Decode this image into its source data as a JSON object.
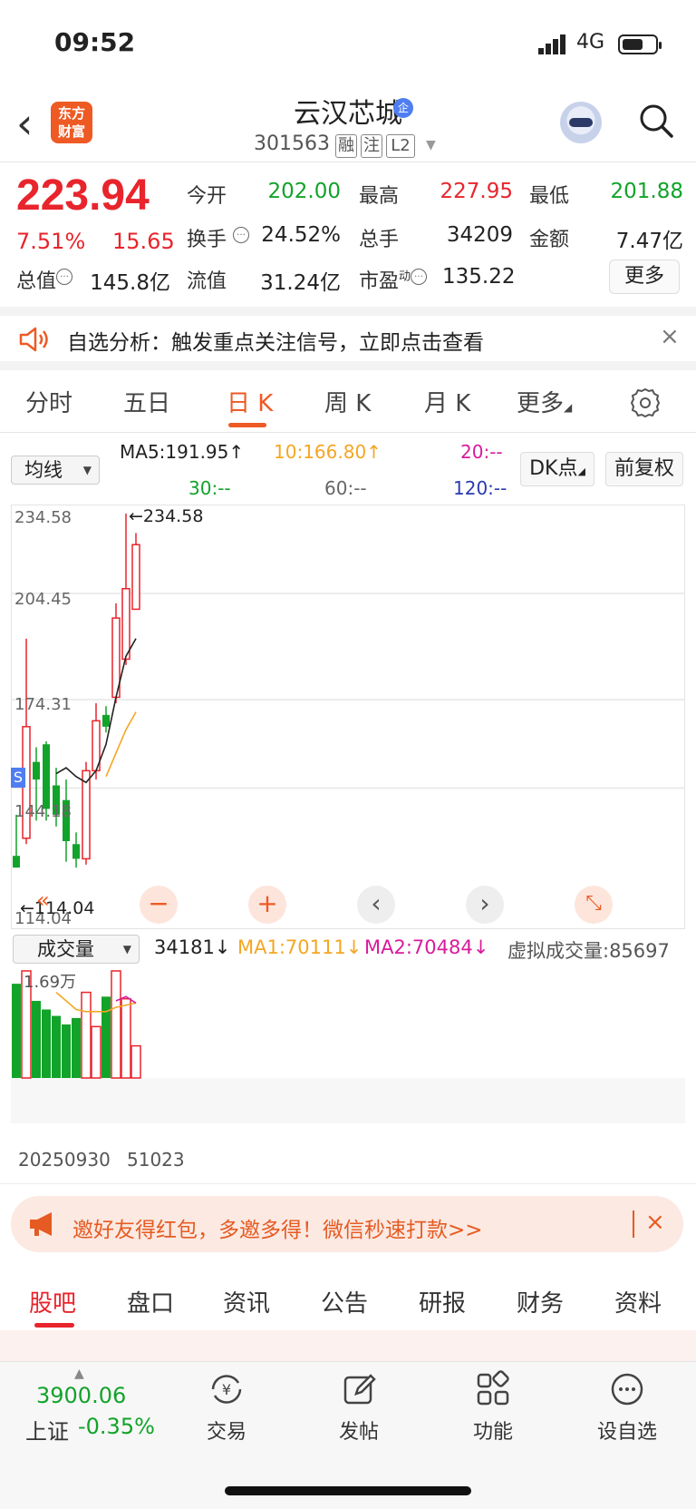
{
  "status": {
    "time": "09:52",
    "network": "4G"
  },
  "header": {
    "logo_line1": "东方",
    "logo_line2": "财富",
    "name": "云汉芯城",
    "badge": "企",
    "code": "301563",
    "tags": [
      "融",
      "注",
      "L2"
    ]
  },
  "quote": {
    "price": "223.94",
    "change_pct": "7.51%",
    "change": "15.65",
    "cells": [
      {
        "label": "今开",
        "value": "202.00",
        "color": "green"
      },
      {
        "label": "最高",
        "value": "227.95",
        "color": "red"
      },
      {
        "label": "最低",
        "value": "201.88",
        "color": "green"
      },
      {
        "label": "换手",
        "value": "24.52%",
        "color": "dark"
      },
      {
        "label": "总手",
        "value": "34209",
        "color": "dark"
      },
      {
        "label": "金额",
        "value": "7.47亿",
        "color": "dark"
      },
      {
        "label": "总值",
        "value": "145.8亿",
        "color": "dark"
      },
      {
        "label": "流值",
        "value": "31.24亿",
        "color": "dark"
      },
      {
        "label": "市盈",
        "value": "135.22",
        "color": "dark"
      }
    ],
    "pe_super": "动",
    "more": "更多"
  },
  "alert": {
    "text": "自选分析：触发重点关注信号，立即点击查看",
    "close": "×"
  },
  "period_tabs": [
    "分时",
    "五日",
    "日 K",
    "周 K",
    "月 K",
    "更多"
  ],
  "indicator": {
    "selector": "均线",
    "ma5": "MA5:191.95↑",
    "ma10": "10:166.80↑",
    "ma20": "20:--",
    "ma30": "30:--",
    "ma60": "60:--",
    "ma120": "120:--",
    "dk_btn": "DK点",
    "fq_btn": "前复权"
  },
  "chart": {
    "y_labels": [
      "234.58",
      "204.45",
      "174.31",
      "144.18",
      "114.04"
    ],
    "high_marker": "←234.58",
    "low_marker": "←114.04",
    "s_badge": "S"
  },
  "volume": {
    "selector": "成交量",
    "value": "34181↓",
    "ma1": "MA1:70111↓",
    "ma2": "MA2:70484↓",
    "virtual": "虚拟成交量:85697",
    "top_label": "1.69万",
    "date_start": "20250930",
    "date_end": "51023"
  },
  "chart_data": {
    "type": "candlestick",
    "ylim": [
      114.04,
      234.58
    ],
    "candles": [
      {
        "o": 118,
        "c": 114,
        "h": 132,
        "l": 114
      },
      {
        "o": 124,
        "c": 162,
        "h": 192,
        "l": 122
      },
      {
        "o": 150,
        "c": 144,
        "h": 155,
        "l": 130
      },
      {
        "o": 156,
        "c": 134,
        "h": 157,
        "l": 130
      },
      {
        "o": 142,
        "c": 132,
        "h": 148,
        "l": 128
      },
      {
        "o": 137,
        "c": 123,
        "h": 144,
        "l": 116
      },
      {
        "o": 122,
        "c": 117,
        "h": 126,
        "l": 114
      },
      {
        "o": 117,
        "c": 147,
        "h": 150,
        "l": 115
      },
      {
        "o": 147,
        "c": 164,
        "h": 170,
        "l": 144
      },
      {
        "o": 166,
        "c": 162,
        "h": 169,
        "l": 160
      },
      {
        "o": 172,
        "c": 199,
        "h": 204,
        "l": 170
      },
      {
        "o": 185,
        "c": 209,
        "h": 234.58,
        "l": 183
      },
      {
        "o": 202,
        "c": 224,
        "h": 227.95,
        "l": 201.88
      }
    ],
    "ma5": [
      null,
      null,
      null,
      null,
      146,
      148,
      145,
      143,
      147,
      156,
      172,
      186,
      192
    ],
    "ma10": [
      null,
      null,
      null,
      null,
      null,
      null,
      null,
      null,
      null,
      145,
      153,
      161,
      167
    ],
    "volume": [
      88,
      100,
      72,
      64,
      58,
      50,
      56,
      80,
      48,
      76,
      100,
      74,
      30
    ],
    "vol_ma1": [
      null,
      null,
      null,
      null,
      80,
      72,
      64,
      62,
      62,
      62,
      66,
      68,
      70
    ],
    "vol_ma2": [
      null,
      null,
      null,
      null,
      null,
      null,
      null,
      null,
      null,
      null,
      72,
      76,
      70
    ]
  },
  "invite": {
    "text": "邀好友得红包，多邀多得！微信秒速打款>>",
    "close": "×"
  },
  "bottom_tabs": [
    "股吧",
    "盘口",
    "资讯",
    "公告",
    "研报",
    "财务",
    "资料"
  ],
  "index": {
    "value": "3900.06",
    "name": "上证",
    "change": "-0.35%"
  },
  "nav": [
    "交易",
    "发帖",
    "功能",
    "设自选"
  ],
  "colors": {
    "up": "#e8242c",
    "down": "#12a32a",
    "accent": "#ee5a24"
  }
}
